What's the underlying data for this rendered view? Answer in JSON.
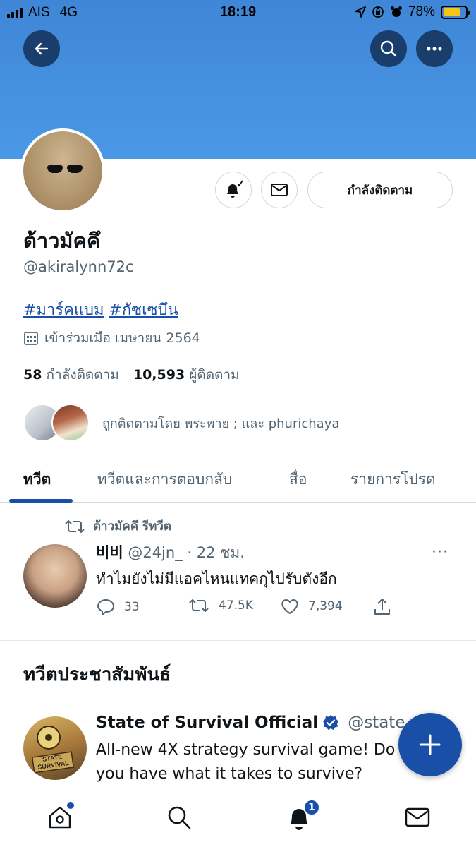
{
  "status_bar": {
    "carrier": "AIS",
    "network": "4G",
    "time": "18:19",
    "battery": "78%",
    "battery_level": 0.78,
    "battery_color": "#f5c518"
  },
  "header": {
    "back_icon": "back-arrow-icon",
    "search_icon": "search-icon",
    "more_icon": "more-icon"
  },
  "profile": {
    "display_name": "ต้าวมัคคึ",
    "handle": "@akiralynn72c",
    "bio_tags": [
      "#มาร์คแบม",
      "#กัซเซบึน"
    ],
    "joined": "เข้าร่วมเมือ เมษายน 2564",
    "following_count": "58",
    "following_label": "กำลังติดตาม",
    "followers_count": "10,593",
    "followers_label": "ผู้ติดตาม",
    "followed_by": "ถูกติดตามโดย พระพาย ; และ phurichaya",
    "following_button": "กำลังติดตาม"
  },
  "tabs": [
    {
      "label": "ทวีต",
      "active": true
    },
    {
      "label": "ทวีตและการตอบกลับ",
      "active": false
    },
    {
      "label": "สื่อ",
      "active": false
    },
    {
      "label": "รายการโปรด",
      "active": false
    }
  ],
  "tweet": {
    "retweet_label": "ต้าวมัคคึ รีทวีต",
    "author": "비비",
    "handle": "@24jn_",
    "time": "· 22 ชม.",
    "more": "···",
    "text": "ทำไมยังไม่มีแอคไหนแทคกุไปรับตังอีก",
    "replies": "33",
    "retweets": "47.5K",
    "likes": "7,394"
  },
  "promoted": {
    "section_title": "ทวีตประชาสัมพันธ์",
    "author": "State of Survival Official",
    "handle": "@state_s",
    "text": "All-new 4X strategy survival game! Do you have what it takes to survive?",
    "avatar_text": "STATE SURVIVAL"
  },
  "bottom_nav": {
    "notifications_badge": "1",
    "accent_color": "#1a4fa8"
  }
}
